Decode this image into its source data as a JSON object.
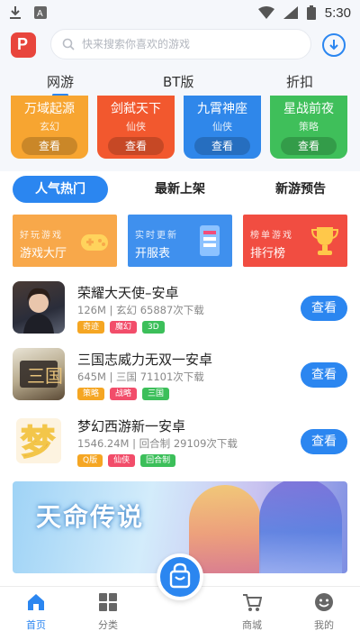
{
  "status_bar": {
    "time": "5:30"
  },
  "header": {
    "search_placeholder": "快来搜索你喜欢的游戏"
  },
  "top_tabs": [
    {
      "label": "网游",
      "active": true
    },
    {
      "label": "BT版",
      "active": false
    },
    {
      "label": "折扣",
      "active": false
    }
  ],
  "category_cards": [
    {
      "title": "万域起源",
      "subtitle": "玄幻",
      "button": "查看",
      "color": "#f7a531"
    },
    {
      "title": "剑弑天下",
      "subtitle": "仙侠",
      "button": "查看",
      "color": "#f2582e"
    },
    {
      "title": "九霄神座",
      "subtitle": "仙侠",
      "button": "查看",
      "color": "#2f87ea"
    },
    {
      "title": "星战前夜",
      "subtitle": "策略",
      "button": "查看",
      "color": "#3fbf5a"
    }
  ],
  "section_tabs": [
    {
      "label": "人气热门",
      "active": true
    },
    {
      "label": "最新上架",
      "active": false
    },
    {
      "label": "新游预告",
      "active": false
    }
  ],
  "banners": [
    {
      "line1": "好玩游戏",
      "line2": "游戏大厅",
      "color": "#f8a84a",
      "icon_color": "#ffd35c",
      "icon": "gamepad-icon"
    },
    {
      "line1": "实时更新",
      "line2": "开服表",
      "color": "#3f90ee",
      "icon_color": "#8cc2ff",
      "icon": "phone-list-icon"
    },
    {
      "line1": "榜单游戏",
      "line2": "排行榜",
      "color": "#f14d41",
      "icon_color": "#ffc84a",
      "icon": "trophy-icon"
    }
  ],
  "games": [
    {
      "title": "荣耀大天使–安卓",
      "meta": "126M | 玄幻  65887次下载",
      "tags": [
        {
          "text": "奇迹",
          "color": "#f5a623"
        },
        {
          "text": "魔幻",
          "color": "#f24d6a"
        },
        {
          "text": "3D",
          "color": "#3cbf5a"
        }
      ],
      "button": "查看"
    },
    {
      "title": "三国志威力无双一安卓",
      "meta": "645M | 三国  71101次下载",
      "tags": [
        {
          "text": "策略",
          "color": "#f5a623"
        },
        {
          "text": "战略",
          "color": "#f24d6a"
        },
        {
          "text": "三国",
          "color": "#3cbf5a"
        }
      ],
      "button": "查看"
    },
    {
      "title": "梦幻西游新一安卓",
      "meta": "1546.24M | 回合制  29109次下载",
      "tags": [
        {
          "text": "Q版",
          "color": "#f5a623"
        },
        {
          "text": "仙侠",
          "color": "#f24d6a"
        },
        {
          "text": "回合制",
          "color": "#3cbf5a"
        }
      ],
      "button": "查看"
    }
  ],
  "featured_banner": {
    "title": "天命传说"
  },
  "bottom_nav": [
    {
      "label": "首页",
      "icon": "home-icon",
      "active": true
    },
    {
      "label": "分类",
      "icon": "grid-icon",
      "active": false
    },
    {
      "label": "商城",
      "icon": "cart-icon",
      "active": false
    },
    {
      "label": "我的",
      "icon": "user-icon",
      "active": false
    }
  ],
  "accent_color": "#2b86f0"
}
